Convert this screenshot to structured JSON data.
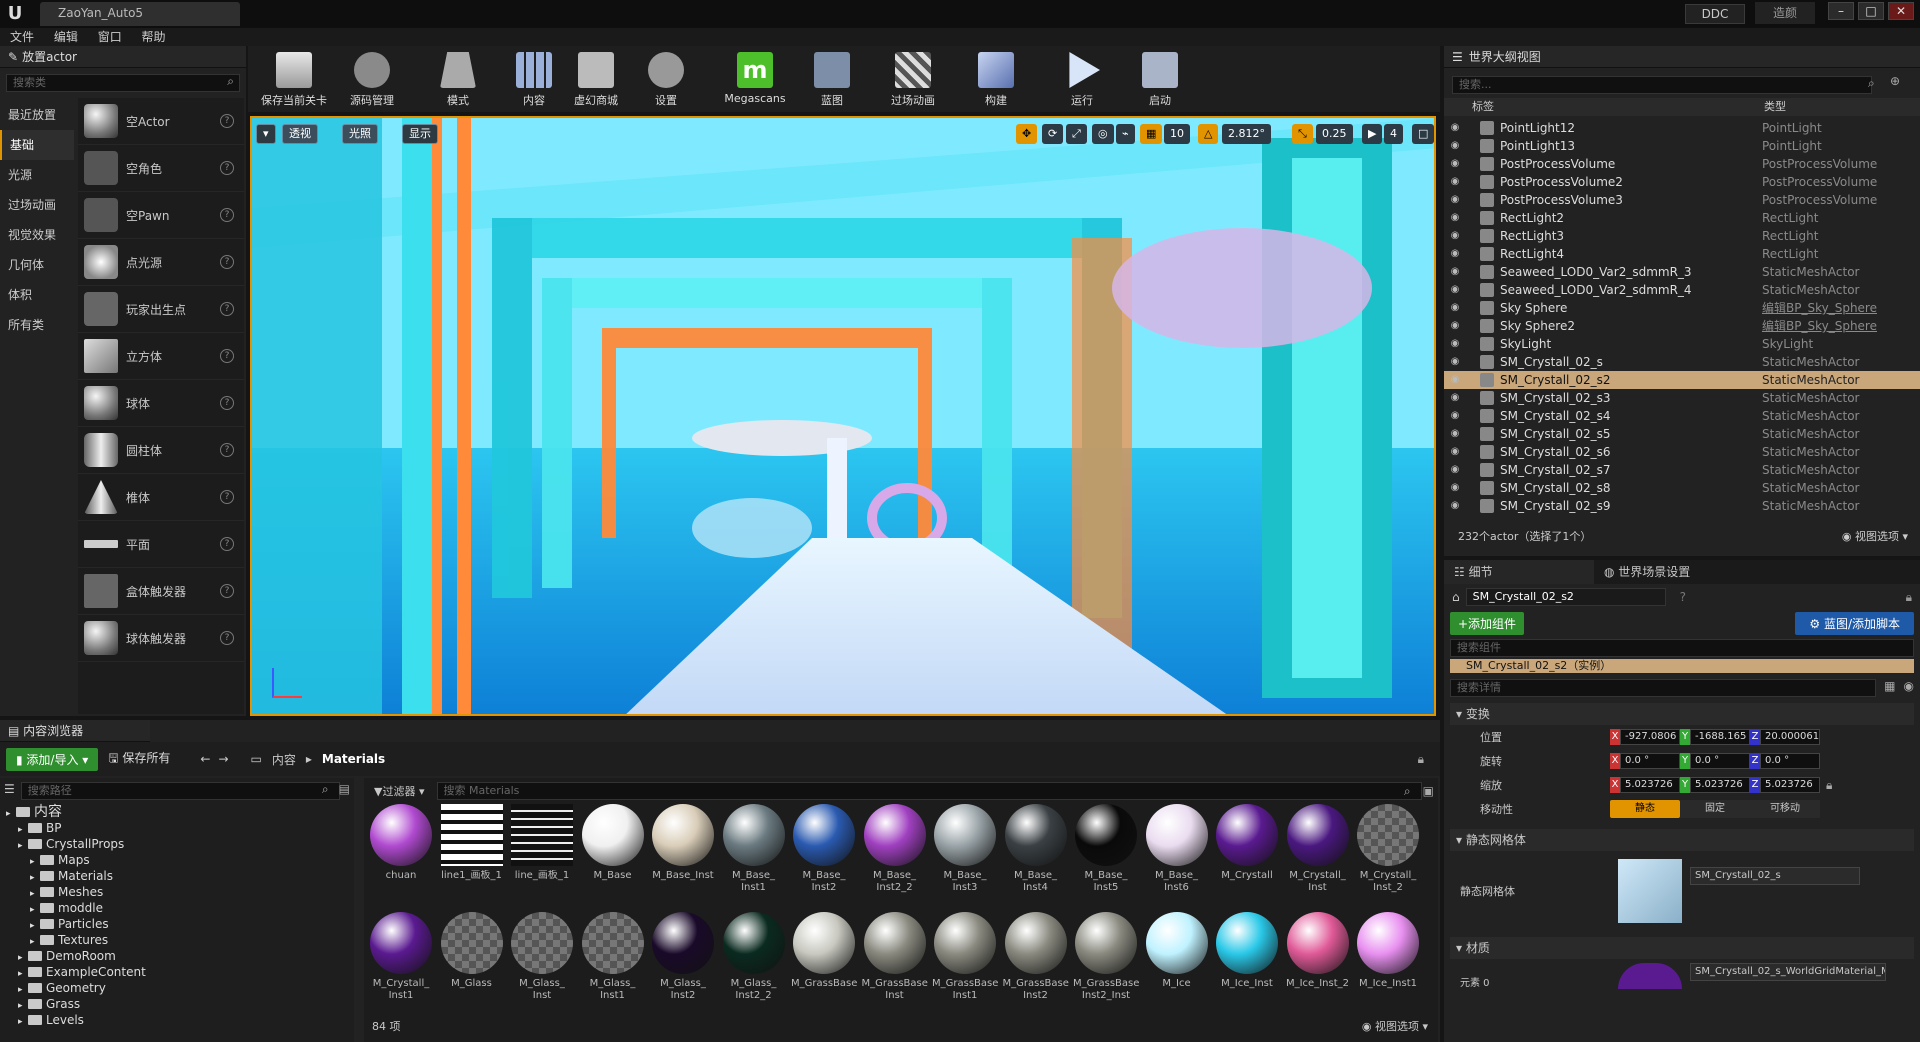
{
  "app": {
    "logo": "U",
    "project_tab": "ZaoYan_Auto5",
    "ddc_label": "DDC",
    "brand": "造颜"
  },
  "menu": [
    "文件",
    "编辑",
    "窗口",
    "帮助"
  ],
  "place_panel": {
    "title": "放置actor",
    "search_placeholder": "搜索类",
    "categories": [
      "最近放置",
      "基础",
      "光源",
      "过场动画",
      "视觉效果",
      "几何体",
      "体积",
      "所有类"
    ],
    "selected_category": "基础",
    "items": [
      "空Actor",
      "空角色",
      "空Pawn",
      "点光源",
      "玩家出生点",
      "立方体",
      "球体",
      "圆柱体",
      "椎体",
      "平面",
      "盒体触发器",
      "球体触发器"
    ]
  },
  "toolbar": [
    {
      "label": "保存当前关卡",
      "icon": "save-icon"
    },
    {
      "label": "源码管理",
      "icon": "source-control-icon"
    },
    {
      "label": "模式",
      "icon": "modes-icon"
    },
    {
      "label": "内容",
      "icon": "content-icon"
    },
    {
      "label": "虚幻商城",
      "icon": "marketplace-icon"
    },
    {
      "label": "设置",
      "icon": "settings-icon"
    },
    {
      "label": "Megascans",
      "icon": "megascans-icon"
    },
    {
      "label": "蓝图",
      "icon": "blueprint-icon"
    },
    {
      "label": "过场动画",
      "icon": "cinematics-icon"
    },
    {
      "label": "构建",
      "icon": "build-icon"
    },
    {
      "label": "运行",
      "icon": "play-icon"
    },
    {
      "label": "启动",
      "icon": "launch-icon"
    }
  ],
  "viewport": {
    "perspective_label": "透视",
    "lit_label": "光照",
    "show_label": "显示",
    "grid_snap": "10",
    "rotation_snap": "2.812°",
    "scale_snap": "0.25",
    "camera_speed": "4"
  },
  "outliner": {
    "title": "世界大纲视图",
    "search_placeholder": "搜索...",
    "col_label": "标签",
    "col_type": "类型",
    "rows": [
      {
        "label": "PointLight12",
        "type": "PointLight"
      },
      {
        "label": "PointLight13",
        "type": "PointLight"
      },
      {
        "label": "PostProcessVolume",
        "type": "PostProcessVolume"
      },
      {
        "label": "PostProcessVolume2",
        "type": "PostProcessVolume"
      },
      {
        "label": "PostProcessVolume3",
        "type": "PostProcessVolume"
      },
      {
        "label": "RectLight2",
        "type": "RectLight"
      },
      {
        "label": "RectLight3",
        "type": "RectLight"
      },
      {
        "label": "RectLight4",
        "type": "RectLight"
      },
      {
        "label": "Seaweed_LOD0_Var2_sdmmR_3",
        "type": "StaticMeshActor"
      },
      {
        "label": "Seaweed_LOD0_Var2_sdmmR_4",
        "type": "StaticMeshActor"
      },
      {
        "label": "Sky Sphere",
        "type": "编辑BP_Sky_Sphere"
      },
      {
        "label": "Sky Sphere2",
        "type": "编辑BP_Sky_Sphere"
      },
      {
        "label": "SkyLight",
        "type": "SkyLight"
      },
      {
        "label": "SM_Crystall_02_s",
        "type": "StaticMeshActor"
      },
      {
        "label": "SM_Crystall_02_s2",
        "type": "StaticMeshActor"
      },
      {
        "label": "SM_Crystall_02_s3",
        "type": "StaticMeshActor"
      },
      {
        "label": "SM_Crystall_02_s4",
        "type": "StaticMeshActor"
      },
      {
        "label": "SM_Crystall_02_s5",
        "type": "StaticMeshActor"
      },
      {
        "label": "SM_Crystall_02_s6",
        "type": "StaticMeshActor"
      },
      {
        "label": "SM_Crystall_02_s7",
        "type": "StaticMeshActor"
      },
      {
        "label": "SM_Crystall_02_s8",
        "type": "StaticMeshActor"
      },
      {
        "label": "SM_Crystall_02_s9",
        "type": "StaticMeshActor"
      }
    ],
    "status": "232个actor（选择了1个）",
    "view_options": "视图选项"
  },
  "details": {
    "tab_details": "细节",
    "tab_world": "世界场景设置",
    "actor_name": "SM_Crystall_02_s2",
    "add_component": "+添加组件",
    "blueprint_button": "蓝图/添加脚本",
    "search_components": "搜索组件",
    "component_row": "SM_Crystall_02_s2（实例）",
    "search_details": "搜索详情",
    "transform_header": "变换",
    "location_label": "位置",
    "rotation_label": "旋转",
    "scale_label": "缩放",
    "mobility_label": "移动性",
    "location": [
      "-927.0806",
      "-1688.165",
      "20.000061"
    ],
    "rotation": [
      "0.0 °",
      "0.0 °",
      "0.0 °"
    ],
    "scale": [
      "5.023726",
      "5.023726",
      "5.023726"
    ],
    "mobility": [
      "静态",
      "固定",
      "可移动"
    ],
    "static_mesh_header": "静态网格体",
    "static_mesh_label": "静态网格体",
    "static_mesh_value": "SM_Crystall_02_s",
    "materials_header": "材质",
    "element_label": "元素 0",
    "material_value": "SM_Crystall_02_s_WorldGridMaterial_M"
  },
  "content_browser": {
    "title": "内容浏览器",
    "add_import": "添加/导入",
    "save_all": "保存所有",
    "breadcrumb": [
      "内容",
      "Materials"
    ],
    "search_paths": "搜索路径",
    "filters": "过滤器",
    "search_materials": "搜索 Materials",
    "tree": [
      {
        "label": "内容",
        "depth": 0
      },
      {
        "label": "BP",
        "depth": 1
      },
      {
        "label": "CrystallProps",
        "depth": 1
      },
      {
        "label": "Maps",
        "depth": 2
      },
      {
        "label": "Materials",
        "depth": 2
      },
      {
        "label": "Meshes",
        "depth": 2
      },
      {
        "label": "moddle",
        "depth": 2
      },
      {
        "label": "Particles",
        "depth": 2
      },
      {
        "label": "Textures",
        "depth": 2
      },
      {
        "label": "DemoRoom",
        "depth": 1
      },
      {
        "label": "ExampleContent",
        "depth": 1
      },
      {
        "label": "Geometry",
        "depth": 1
      },
      {
        "label": "Grass",
        "depth": 1
      },
      {
        "label": "Levels",
        "depth": 1
      }
    ],
    "assets_row1": [
      {
        "name": "chuan",
        "color": "#b04ad0"
      },
      {
        "name": "line1_画板_1",
        "color": "stripes-white"
      },
      {
        "name": "line_画板_1",
        "color": "stripes-dark"
      },
      {
        "name": "M_Base",
        "color": "#f0f0f0"
      },
      {
        "name": "M_Base_Inst",
        "color": "#d9cdb8"
      },
      {
        "name": "M_Base_\nInst1",
        "color": "#6a7a80"
      },
      {
        "name": "M_Base_\nInst2",
        "color": "#2a5ab0"
      },
      {
        "name": "M_Base_\nInst2_2",
        "color": "#a040c0"
      },
      {
        "name": "M_Base_\nInst3",
        "color": "#9aa4a8"
      },
      {
        "name": "M_Base_\nInst4",
        "color": "#3a4044"
      },
      {
        "name": "M_Base_\nInst5",
        "color": "#0a0a0a"
      },
      {
        "name": "M_Base_\nInst6",
        "color": "#eadcf0"
      },
      {
        "name": "M_Crystall",
        "color": "#5a1a90"
      },
      {
        "name": "M_Crystall_\nInst",
        "color": "#4a1880"
      },
      {
        "name": "M_Crystall_\nInst_2",
        "color": "checker"
      }
    ],
    "assets_row2": [
      {
        "name": "M_Crystall_\nInst1",
        "color": "#5a1a90"
      },
      {
        "name": "M_Glass",
        "color": "checker"
      },
      {
        "name": "M_Glass_\nInst",
        "color": "checker"
      },
      {
        "name": "M_Glass_\nInst1",
        "color": "checker"
      },
      {
        "name": "M_Glass_\nInst2",
        "color": "#1a0a2a"
      },
      {
        "name": "M_Glass_\nInst2_2",
        "color": "#0a2a20"
      },
      {
        "name": "M_GrassBase",
        "color": "#c8c8c0"
      },
      {
        "name": "M_GrassBase\nInst",
        "color": "#8a8a80"
      },
      {
        "name": "M_GrassBase\nInst1",
        "color": "#8a8a80"
      },
      {
        "name": "M_GrassBase\nInst2",
        "color": "#8a8a80"
      },
      {
        "name": "M_GrassBase\nInst2_Inst",
        "color": "#8a8a80"
      },
      {
        "name": "M_Ice",
        "color": "#bff2ff"
      },
      {
        "name": "M_Ice_Inst",
        "color": "#2ac8e8"
      },
      {
        "name": "M_Ice_Inst_2",
        "color": "#e05a98"
      },
      {
        "name": "M_Ice_Inst1",
        "color": "#e890f0"
      }
    ],
    "item_count": "84 项",
    "view_options": "视图选项"
  }
}
